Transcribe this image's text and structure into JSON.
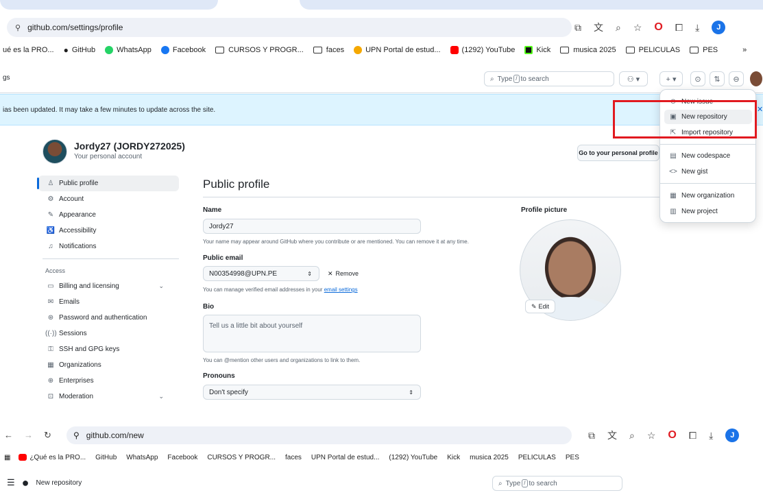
{
  "browser_top": {
    "url": "github.com/settings/profile",
    "avatar_letter": "J"
  },
  "bookmarks": [
    {
      "label": "ué es la PRO...",
      "icon": "none"
    },
    {
      "label": "GitHub",
      "icon": "github-icon"
    },
    {
      "label": "WhatsApp",
      "icon": "whatsapp-icon"
    },
    {
      "label": "Facebook",
      "icon": "facebook-icon"
    },
    {
      "label": "CURSOS Y PROGR...",
      "icon": "folder-icon"
    },
    {
      "label": "faces",
      "icon": "folder-icon"
    },
    {
      "label": "UPN Portal de estud...",
      "icon": "upn-icon"
    },
    {
      "label": "(1292) YouTube",
      "icon": "youtube-icon"
    },
    {
      "label": "Kick",
      "icon": "kick-icon"
    },
    {
      "label": "musica 2025",
      "icon": "folder-icon"
    },
    {
      "label": "PELICULAS",
      "icon": "folder-icon"
    },
    {
      "label": "PES",
      "icon": "folder-icon"
    }
  ],
  "header": {
    "breadcrumb": "gs",
    "search_prefix": "Type",
    "search_key": "/",
    "search_suffix": "to search"
  },
  "flash": {
    "message": "ias been updated. It may take a few minutes to update across the site."
  },
  "profile": {
    "display": "Jordy27 (JORDY272025)",
    "subtitle": "Your personal account",
    "goto_button": "Go to your personal profile"
  },
  "sidebar": {
    "items": [
      {
        "label": "Public profile",
        "icon": "person-icon"
      },
      {
        "label": "Account",
        "icon": "gear-icon"
      },
      {
        "label": "Appearance",
        "icon": "paintbrush-icon"
      },
      {
        "label": "Accessibility",
        "icon": "accessibility-icon"
      },
      {
        "label": "Notifications",
        "icon": "bell-icon"
      }
    ],
    "access_heading": "Access",
    "access_items": [
      {
        "label": "Billing and licensing",
        "icon": "credit-card-icon"
      },
      {
        "label": "Emails",
        "icon": "mail-icon"
      },
      {
        "label": "Password and authentication",
        "icon": "shield-icon"
      },
      {
        "label": "Sessions",
        "icon": "broadcast-icon"
      },
      {
        "label": "SSH and GPG keys",
        "icon": "key-icon"
      },
      {
        "label": "Organizations",
        "icon": "organization-icon"
      },
      {
        "label": "Enterprises",
        "icon": "globe-icon"
      },
      {
        "label": "Moderation",
        "icon": "report-icon"
      }
    ]
  },
  "main": {
    "title": "Public profile",
    "name_label": "Name",
    "name_value": "Jordy27",
    "name_note": "Your name may appear around GitHub where you contribute or are mentioned. You can remove it at any time.",
    "email_label": "Public email",
    "email_value": "N00354998@UPN.PE",
    "remove_label": "Remove",
    "email_note_prefix": "You can manage verified email addresses in your",
    "email_note_link": "email settings",
    "bio_label": "Bio",
    "bio_placeholder": "Tell us a little bit about yourself",
    "bio_note": "You can @mention other users and organizations to link to them.",
    "pronouns_label": "Pronouns",
    "pronouns_value": "Don't specify",
    "picture_label": "Profile picture",
    "edit_label": "Edit"
  },
  "create_menu": {
    "items": [
      {
        "label": "New issue",
        "icon": "issue-icon"
      },
      {
        "label": "New repository",
        "icon": "repo-icon"
      },
      {
        "label": "Import repository",
        "icon": "import-icon"
      },
      {
        "label": "New codespace",
        "icon": "codespace-icon"
      },
      {
        "label": "New gist",
        "icon": "code-icon"
      },
      {
        "label": "New organization",
        "icon": "organization-icon"
      },
      {
        "label": "New project",
        "icon": "project-icon"
      }
    ],
    "highlight_color": "#e1191f"
  },
  "browser_bottom": {
    "url": "github.com/new",
    "first_bookmark": "¿Qué es la PRO...",
    "page_title": "New repository"
  }
}
